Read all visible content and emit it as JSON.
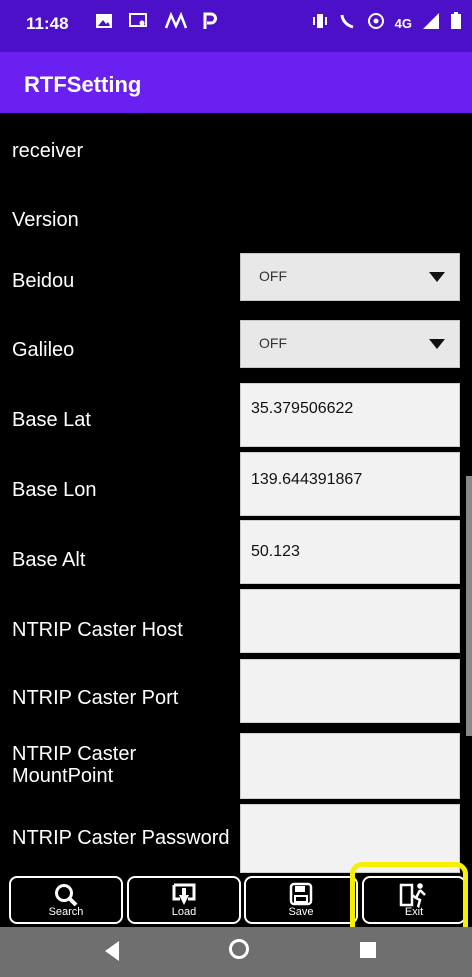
{
  "statusbar": {
    "time": "11:48",
    "icons_left": [
      "image-icon",
      "screencast-icon",
      "signal-wave-icon",
      "parking-icon"
    ],
    "icons_right": [
      "vibrate-icon",
      "call-4g-icon",
      "hotspot-icon",
      "network-4g-icon",
      "signal-icon",
      "battery-icon"
    ],
    "network_label": "4G"
  },
  "app": {
    "title": "RTFSetting"
  },
  "form": {
    "rows": [
      {
        "label": "receiver"
      },
      {
        "label": "Version"
      },
      {
        "label": "Beidou",
        "type": "select",
        "value": "OFF"
      },
      {
        "label": "Galileo",
        "type": "select",
        "value": "OFF"
      },
      {
        "label": "Base Lat",
        "type": "input",
        "value": "35.379506622"
      },
      {
        "label": "Base Lon",
        "type": "input",
        "value": "139.644391867"
      },
      {
        "label": "Base Alt",
        "type": "input",
        "value": "50.123"
      },
      {
        "label": "NTRIP Caster Host",
        "type": "input",
        "value": ""
      },
      {
        "label": "NTRIP Caster Port",
        "type": "input",
        "value": ""
      },
      {
        "label_lines": [
          "NTRIP Caster",
          "MountPoint"
        ],
        "type": "input",
        "value": ""
      },
      {
        "label": "NTRIP Caster Password",
        "type": "input",
        "value": ""
      }
    ]
  },
  "toolbar": {
    "buttons": [
      {
        "label": "Search",
        "icon": "search-icon"
      },
      {
        "label": "Load",
        "icon": "load-icon"
      },
      {
        "label": "Save",
        "icon": "save-icon"
      },
      {
        "label": "Exit",
        "icon": "exit-icon"
      }
    ]
  },
  "navbar": {
    "icons": [
      "back-icon",
      "home-icon",
      "recent-apps-icon"
    ]
  },
  "colors": {
    "statusbar": "#4b10c8",
    "appbar": "#6a20f0",
    "highlight": "#f6f000",
    "navbar": "#6f6f6f"
  }
}
